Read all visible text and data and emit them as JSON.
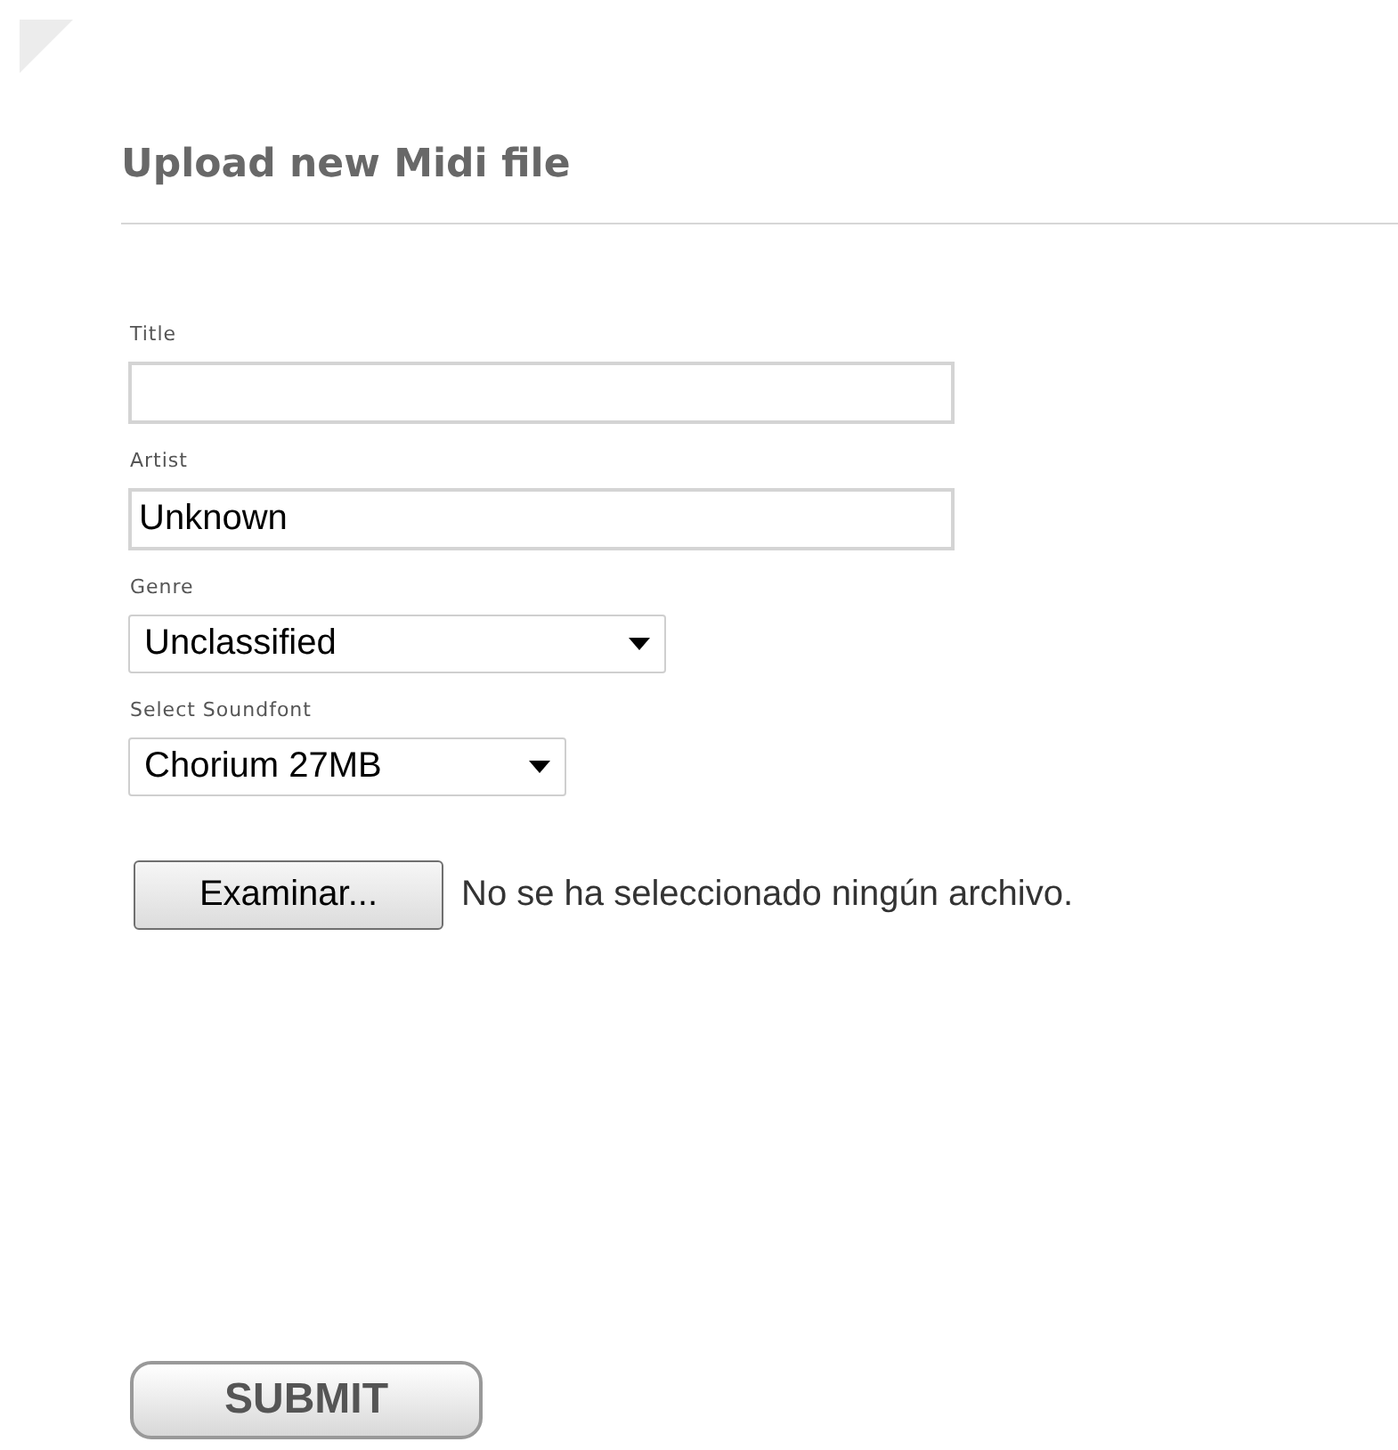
{
  "heading": "Upload new Midi file",
  "fields": [
    {
      "kind": "text",
      "label": "Title"
    },
    {
      "kind": "text",
      "label": "Artist",
      "value": "Unknown"
    },
    {
      "kind": "select",
      "label": "Genre",
      "value": "Unclassified"
    },
    {
      "kind": "select",
      "label": "Select Soundfont",
      "value": "Chorium 27MB"
    },
    {
      "kind": "file",
      "button": "Examinar...",
      "status": "No se ha seleccionado ningún archivo."
    }
  ],
  "submit": "SUBMIT"
}
